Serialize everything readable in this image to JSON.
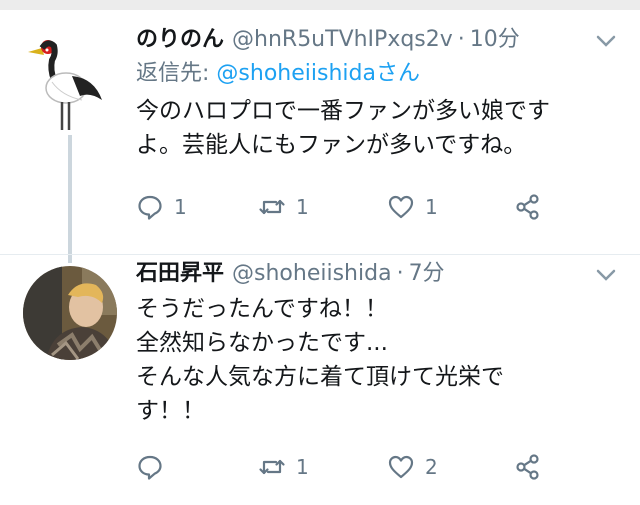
{
  "tweets": [
    {
      "display_name": "のりのん",
      "handle": "@hnR5uTVhIPxqs2v",
      "separator": "·",
      "time": "10分",
      "reply_to_label": "返信先:",
      "reply_to_mention": "@shoheiishidaさん",
      "text_lines": [
        "今のハロプロで一番ファンが多い娘です",
        "よ。芸能人にもファンが多いですね。"
      ],
      "reply_count": "1",
      "retweet_count": "1",
      "like_count": "1",
      "avatar_icon": "crane-icon"
    },
    {
      "display_name": "石田昇平",
      "handle": "@shoheiishida",
      "separator": "·",
      "time": "7分",
      "text_lines": [
        "そうだったんですね！！",
        "全然知らなかったです...",
        "そんな人気な方に着て頂けて光栄で",
        "す！！"
      ],
      "reply_count": "",
      "retweet_count": "1",
      "like_count": "2",
      "avatar_icon": "user-photo"
    }
  ],
  "colors": {
    "accent": "#1da1f2",
    "muted": "#657786",
    "divider": "#e6ecf0"
  }
}
